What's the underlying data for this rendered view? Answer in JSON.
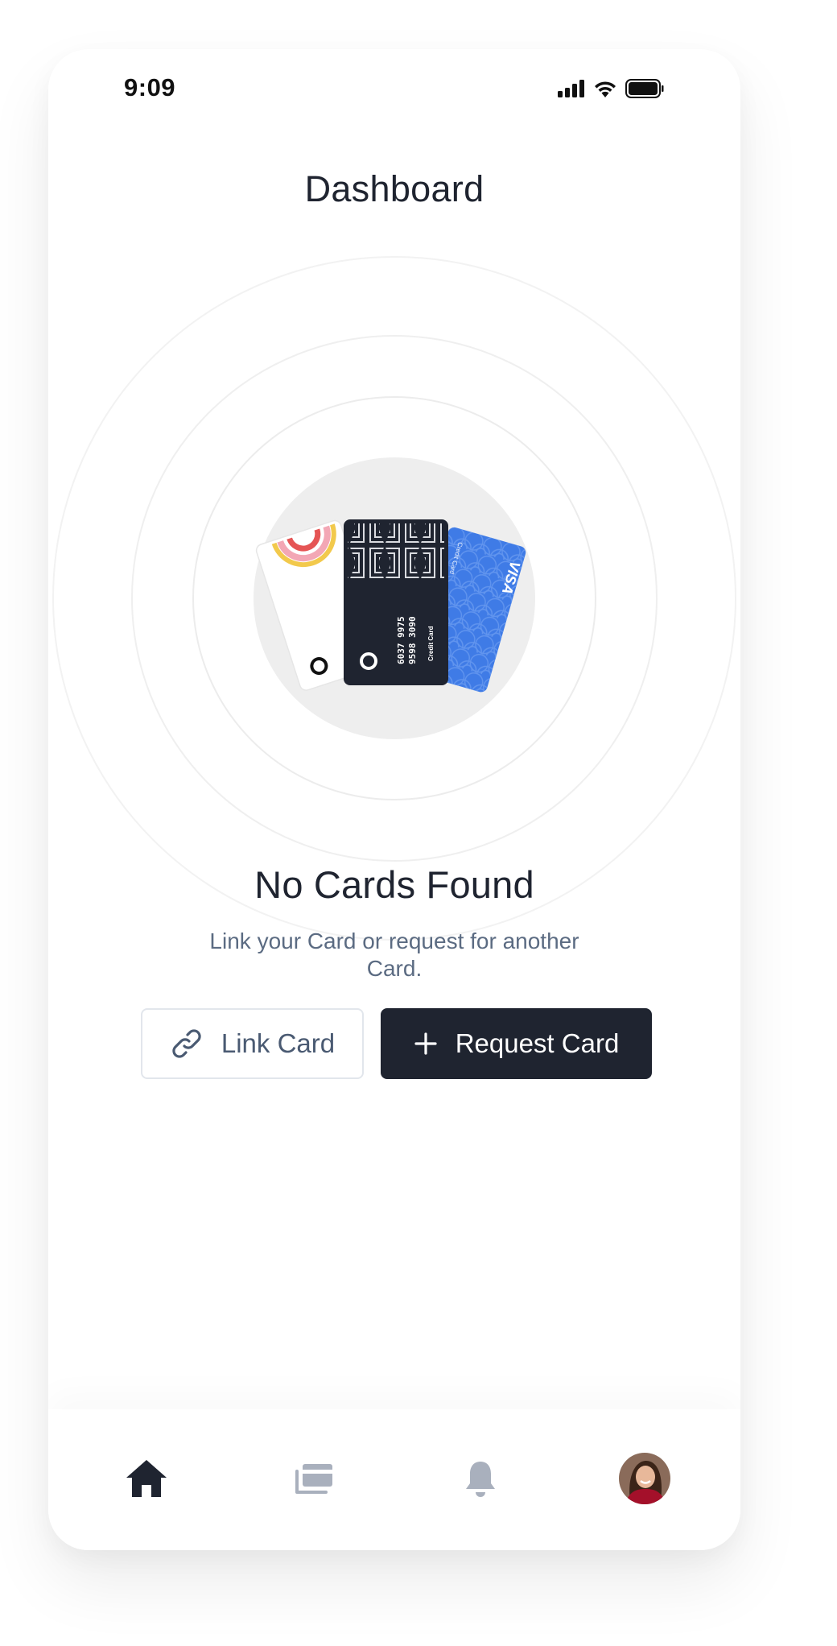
{
  "status_bar": {
    "time": "9:09"
  },
  "header": {
    "title": "Dashboard"
  },
  "illustration": {
    "cards": [
      {
        "name": "white-card",
        "color": "#ffffff"
      },
      {
        "name": "black-credit-card",
        "number_line1": "6037 9975",
        "number_line2": "9598 3090",
        "label": "Credit Card",
        "color": "#1f2430"
      },
      {
        "name": "blue-visa-card",
        "brand": "VISA",
        "label": "Credit Card",
        "color": "#3f7be6"
      }
    ]
  },
  "empty_state": {
    "title": "No Cards Found",
    "subtitle": "Link your Card or request for another Card."
  },
  "actions": {
    "link_card_label": "Link Card",
    "request_card_label": "Request Card"
  },
  "tab_bar": {
    "items": [
      {
        "name": "home",
        "icon": "home-icon",
        "active": true
      },
      {
        "name": "cards",
        "icon": "cards-icon",
        "active": false
      },
      {
        "name": "notifications",
        "icon": "bell-icon",
        "active": false
      },
      {
        "name": "profile",
        "icon": "avatar",
        "active": false
      }
    ]
  },
  "colors": {
    "primary": "#1f2430",
    "muted_text": "#5b6b82",
    "inactive_icon": "#a9b0bd",
    "visa_blue": "#3f7be6"
  }
}
